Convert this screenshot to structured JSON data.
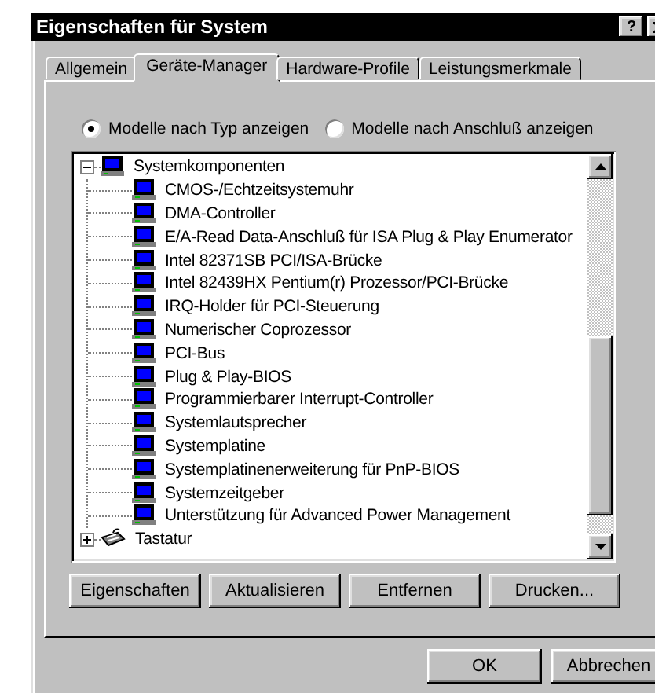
{
  "window": {
    "title": "Eigenschaften für System",
    "title_buttons": [
      "?"
    ]
  },
  "tabs": [
    {
      "label": "Allgemein",
      "selected": false
    },
    {
      "label": "Geräte-Manager",
      "selected": true
    },
    {
      "label": "Hardware-Profile",
      "selected": false
    },
    {
      "label": "Leistungsmerkmale",
      "selected": false
    }
  ],
  "view_options": [
    {
      "label": "Modelle nach Typ anzeigen",
      "selected": true
    },
    {
      "label": "Modelle nach Anschluß anzeigen",
      "selected": false
    }
  ],
  "device_tree": [
    {
      "label": "Systemkomponenten",
      "kind": "computer",
      "expanded": true,
      "children": [
        {
          "label": "CMOS-/Echtzeitsystemuhr",
          "kind": "computer"
        },
        {
          "label": "DMA-Controller",
          "kind": "computer"
        },
        {
          "label": "E/A-Read Data-Anschluß für ISA Plug & Play Enumerator",
          "kind": "computer"
        },
        {
          "label": "Intel 82371SB PCI/ISA-Brücke",
          "kind": "computer"
        },
        {
          "label": "Intel 82439HX Pentium(r) Prozessor/PCI-Brücke",
          "kind": "computer"
        },
        {
          "label": "IRQ-Holder für PCI-Steuerung",
          "kind": "computer"
        },
        {
          "label": "Numerischer Coprozessor",
          "kind": "computer"
        },
        {
          "label": "PCI-Bus",
          "kind": "computer"
        },
        {
          "label": "Plug & Play-BIOS",
          "kind": "computer"
        },
        {
          "label": "Programmierbarer Interrupt-Controller",
          "kind": "computer"
        },
        {
          "label": "Systemlautsprecher",
          "kind": "computer"
        },
        {
          "label": "Systemplatine",
          "kind": "computer"
        },
        {
          "label": "Systemplatinenerweiterung für PnP-BIOS",
          "kind": "computer"
        },
        {
          "label": "Systemzeitgeber",
          "kind": "computer"
        },
        {
          "label": "Unterstützung für Advanced Power Management",
          "kind": "computer"
        }
      ]
    },
    {
      "label": "Tastatur",
      "kind": "keyboard",
      "expanded": false
    }
  ],
  "action_buttons": [
    "Eigenschaften",
    "Aktualisieren",
    "Entfernen",
    "Drucken..."
  ],
  "dialog_buttons": [
    "OK",
    "Abbrechen"
  ]
}
